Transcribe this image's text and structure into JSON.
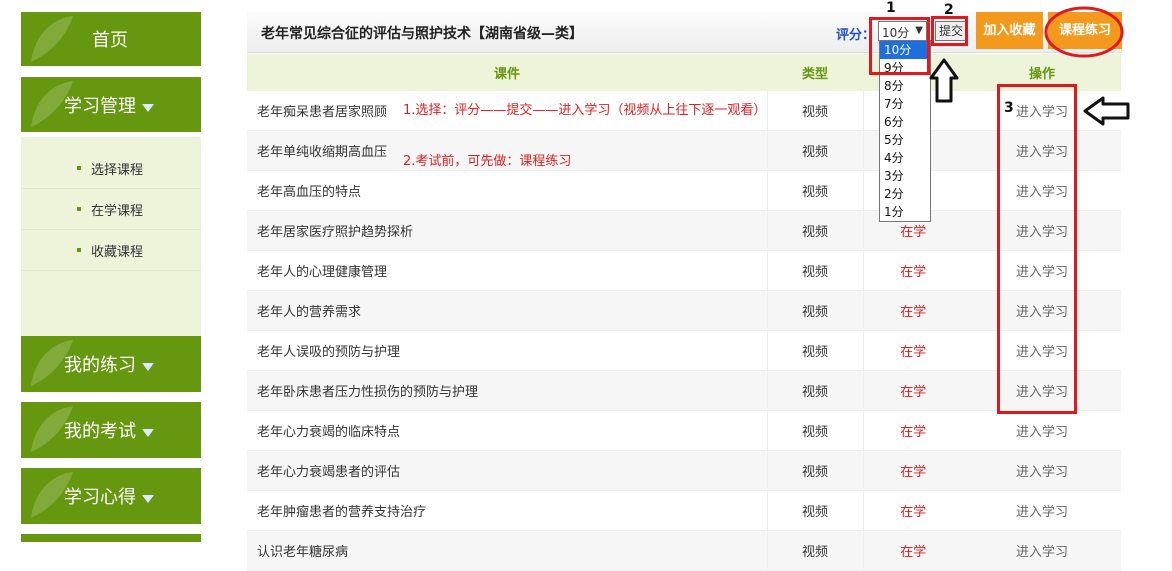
{
  "sidebar": {
    "home": "首页",
    "study": "学习管理",
    "study_items": [
      "选择课程",
      "在学课程",
      "收藏课程"
    ],
    "practice": "我的练习",
    "exam": "我的考试",
    "notes": "学习心得"
  },
  "header": {
    "title": "老年常见综合征的评估与照护技术【湖南省级—类】",
    "rate_label": "评分：",
    "rate_value": "10分",
    "submit": "提交",
    "favorite": "加入收藏",
    "practice": "课程练习"
  },
  "dropdown_options": [
    "10分",
    "9分",
    "8分",
    "7分",
    "6分",
    "5分",
    "4分",
    "3分",
    "2分",
    "1分"
  ],
  "table": {
    "headers": [
      "课件",
      "类型",
      "",
      "操作"
    ],
    "rows": [
      {
        "name": "老年痴呆患者居家照顾",
        "type": "视频",
        "status": "",
        "op": "进入学习"
      },
      {
        "name": "老年单纯收缩期高血压",
        "type": "视频",
        "status": "",
        "op": "进入学习"
      },
      {
        "name": "老年高血压的特点",
        "type": "视频",
        "status": "",
        "op": "进入学习"
      },
      {
        "name": "老年居家医疗照护趋势探析",
        "type": "视频",
        "status": "在学",
        "op": "进入学习"
      },
      {
        "name": "老年人的心理健康管理",
        "type": "视频",
        "status": "在学",
        "op": "进入学习"
      },
      {
        "name": "老年人的营养需求",
        "type": "视频",
        "status": "在学",
        "op": "进入学习"
      },
      {
        "name": "老年人误吸的预防与护理",
        "type": "视频",
        "status": "在学",
        "op": "进入学习"
      },
      {
        "name": "老年卧床患者压力性损伤的预防与护理",
        "type": "视频",
        "status": "在学",
        "op": "进入学习"
      },
      {
        "name": "老年心力衰竭的临床特点",
        "type": "视频",
        "status": "在学",
        "op": "进入学习"
      },
      {
        "name": "老年心力衰竭患者的评估",
        "type": "视频",
        "status": "在学",
        "op": "进入学习"
      },
      {
        "name": "老年肿瘤患者的营养支持治疗",
        "type": "视频",
        "status": "在学",
        "op": "进入学习"
      },
      {
        "name": "认识老年糖尿病",
        "type": "视频",
        "status": "在学",
        "op": "进入学习"
      }
    ]
  },
  "annotations": {
    "note1": "1.选择：评分——提交——进入学习（视频从上往下逐一观看）",
    "note2": "2.考试前，可先做：课程练习",
    "n1": "1",
    "n2": "2",
    "n3": "3"
  },
  "colors": {
    "sidebar_green": "#65970f",
    "submenu_bg": "#eef4da",
    "orange_button": "#f39a1e",
    "annotation_red": "#e0191f",
    "status_red": "#dd1c1c",
    "option_selected": "#1e6ee0"
  }
}
